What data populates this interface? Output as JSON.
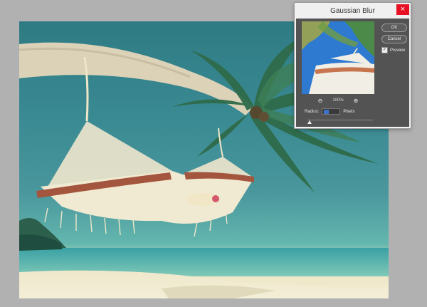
{
  "dialog": {
    "title": "Gaussian Blur",
    "ok_label": "OK",
    "cancel_label": "Cancel",
    "preview_label": "Preview",
    "preview_checked": true,
    "zoom_level": "100%",
    "radius_label": "Radius:",
    "radius_unit": "Pixels",
    "close_glyph": "×"
  },
  "icons": {
    "zoom_out": "zoom-out-icon",
    "zoom_in": "zoom-in-icon",
    "close": "close-icon",
    "check": "checkmark-icon"
  },
  "colors": {
    "workspace": "#b1b1b1",
    "dialog_bg": "#535353",
    "close_button": "#e81123",
    "selection": "#3b73c9"
  }
}
